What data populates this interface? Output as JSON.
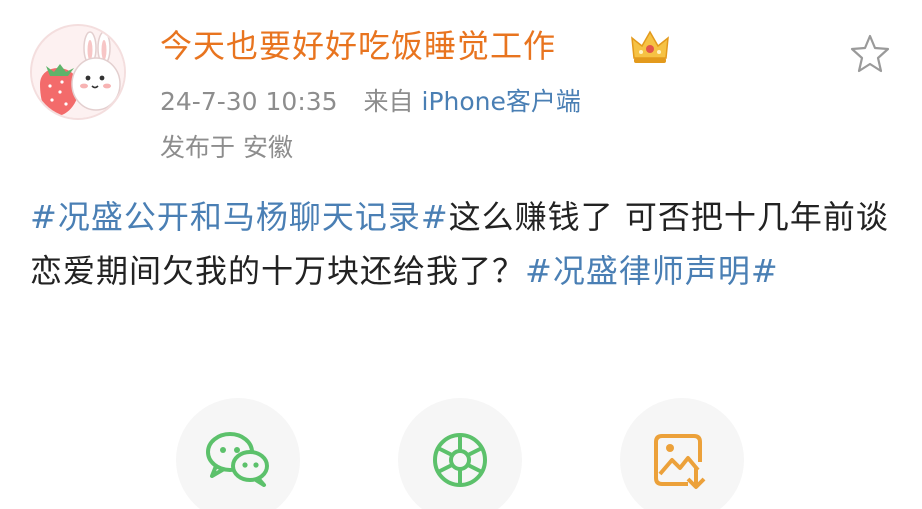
{
  "post": {
    "author": "今天也要好好吃饭睡觉工作",
    "time": "24-7-30 10:35",
    "source_prefix": "来自",
    "client": "iPhone客户端",
    "location": "发布于 安徽",
    "content": {
      "hashtag1": "#况盛公开和马杨聊天记录#",
      "text": "这么赚钱了 可否把十几年前谈恋爱期间欠我的十万块还给我了？",
      "hashtag2": "#况盛律师声明#"
    }
  },
  "icons": {
    "avatar": "strawberry-bunny-avatar",
    "badge": "crown-icon",
    "favorite": "star-icon",
    "share": [
      "wechat-icon",
      "moments-icon",
      "save-image-icon"
    ]
  },
  "colors": {
    "nickname": "#e8741f",
    "link": "#4a7fb4",
    "meta": "#8d8d8d",
    "share_icon": "#5cc16b",
    "save_icon": "#eca13a"
  }
}
